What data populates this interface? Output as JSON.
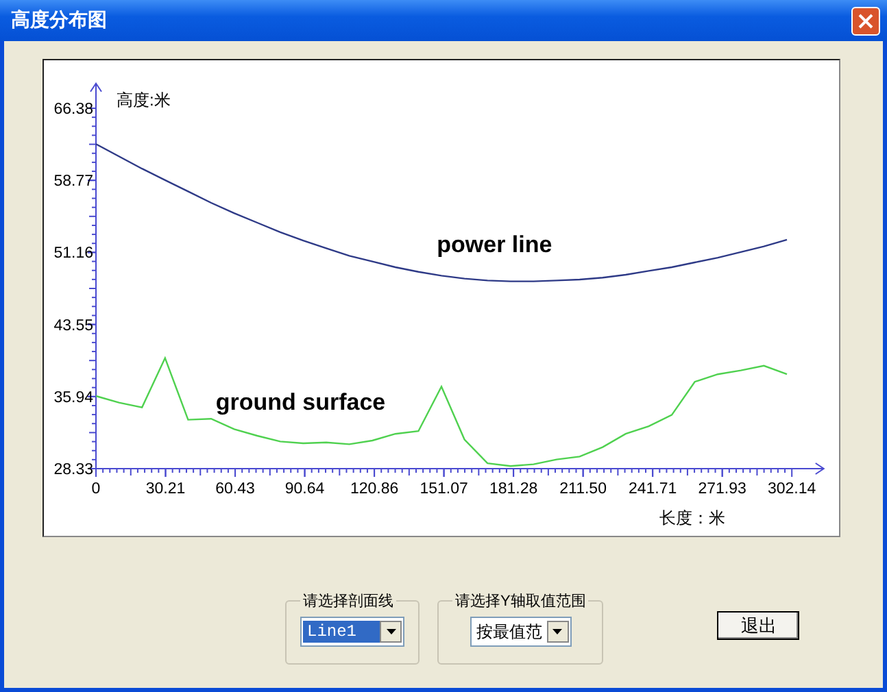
{
  "window": {
    "title": "高度分布图"
  },
  "chart": {
    "chart_data": {
      "type": "line",
      "xlabel": "长度：米",
      "ylabel": "高度:米",
      "x": [
        0,
        10,
        20,
        30,
        40,
        50,
        60,
        70,
        80,
        90,
        100,
        110,
        120,
        130,
        140,
        150,
        160,
        170,
        180,
        190,
        200,
        210,
        220,
        230,
        240,
        250,
        260,
        270,
        280,
        290,
        300
      ],
      "series": [
        {
          "name": "power line",
          "color": "#2e3a87",
          "values": [
            62.6,
            61.3,
            60.0,
            58.8,
            57.6,
            56.4,
            55.3,
            54.3,
            53.3,
            52.4,
            51.6,
            50.8,
            50.2,
            49.6,
            49.1,
            48.7,
            48.4,
            48.2,
            48.1,
            48.1,
            48.2,
            48.3,
            48.5,
            48.8,
            49.2,
            49.6,
            50.1,
            50.6,
            51.2,
            51.8,
            52.5
          ]
        },
        {
          "name": "ground surface",
          "color": "#4fd14f",
          "values": [
            36.0,
            35.3,
            34.8,
            40.0,
            33.5,
            33.6,
            32.5,
            31.8,
            31.2,
            31.0,
            31.1,
            30.9,
            31.3,
            32.0,
            32.3,
            37.0,
            31.4,
            28.9,
            28.6,
            28.8,
            29.3,
            29.6,
            30.6,
            32.0,
            32.8,
            34.0,
            37.5,
            38.3,
            38.7,
            39.2,
            38.3
          ]
        }
      ],
      "xlim": [
        0,
        316
      ],
      "ylim": [
        28.33,
        69.0
      ],
      "xticks": [
        0,
        30.21,
        60.43,
        90.64,
        120.86,
        151.07,
        181.28,
        {
          "value": 211.5,
          "label": "211.50"
        },
        241.71,
        271.93,
        302.14
      ],
      "yticks": [
        28.33,
        35.94,
        43.55,
        51.16,
        58.77,
        66.38
      ]
    }
  },
  "controls": [
    {
      "legend": "请选择剖面线",
      "value": "Line1",
      "highlighted": true
    },
    {
      "legend": "请选择Y轴取值范围",
      "value": "按最值范",
      "highlighted": false
    }
  ],
  "buttons": [
    {
      "label": "退出"
    }
  ]
}
